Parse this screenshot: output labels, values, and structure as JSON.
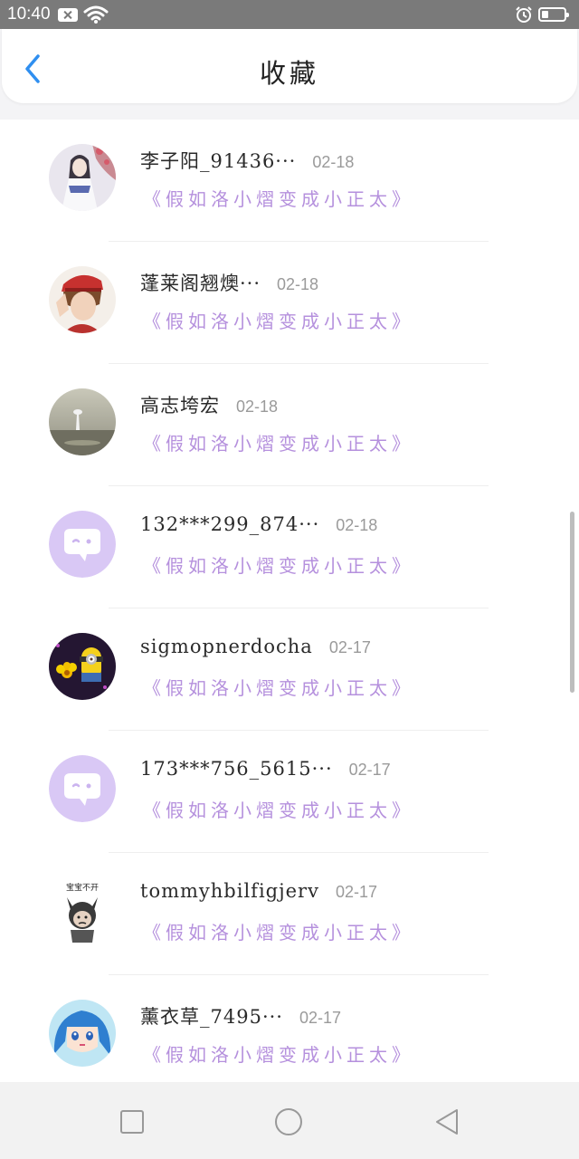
{
  "status_bar": {
    "time": "10:40"
  },
  "header": {
    "title": "收藏"
  },
  "items": [
    {
      "name": "李子阳_91436···",
      "date": "02-18",
      "title": "《假如洛小熠变成小正太》",
      "avatar": "avatar-girl-illustration"
    },
    {
      "name": "蓬莱阁翘燠···",
      "date": "02-18",
      "title": "《假如洛小熠变成小正太》",
      "avatar": "avatar-boy-red-cap"
    },
    {
      "name": "高志垮宏",
      "date": "02-18",
      "title": "《假如洛小熠变成小正太》",
      "avatar": "avatar-landscape-photo"
    },
    {
      "name": "132***299_874···",
      "date": "02-18",
      "title": "《假如洛小熠变成小正太》",
      "avatar": "default-chat-avatar"
    },
    {
      "name": "sigmopnerdocha",
      "date": "02-17",
      "title": "《假如洛小熠变成小正太》",
      "avatar": "avatar-minion-flower"
    },
    {
      "name": "173***756_5615···",
      "date": "02-17",
      "title": "《假如洛小熠变成小正太》",
      "avatar": "default-chat-avatar"
    },
    {
      "name": "tommyhbilfigjerv",
      "date": "02-17",
      "title": "《假如洛小熠变成小正太》",
      "avatar": "avatar-sticker",
      "avatar_text": "宝宝不开"
    },
    {
      "name": "薰衣草_7495···",
      "date": "02-17",
      "title": "《假如洛小熠变成小正太》",
      "avatar": "avatar-anime-blue-hair"
    }
  ],
  "colors": {
    "accent_blue": "#2f8ff0",
    "title_purple": "#b590dd",
    "default_avatar": "#d9c8f5"
  }
}
